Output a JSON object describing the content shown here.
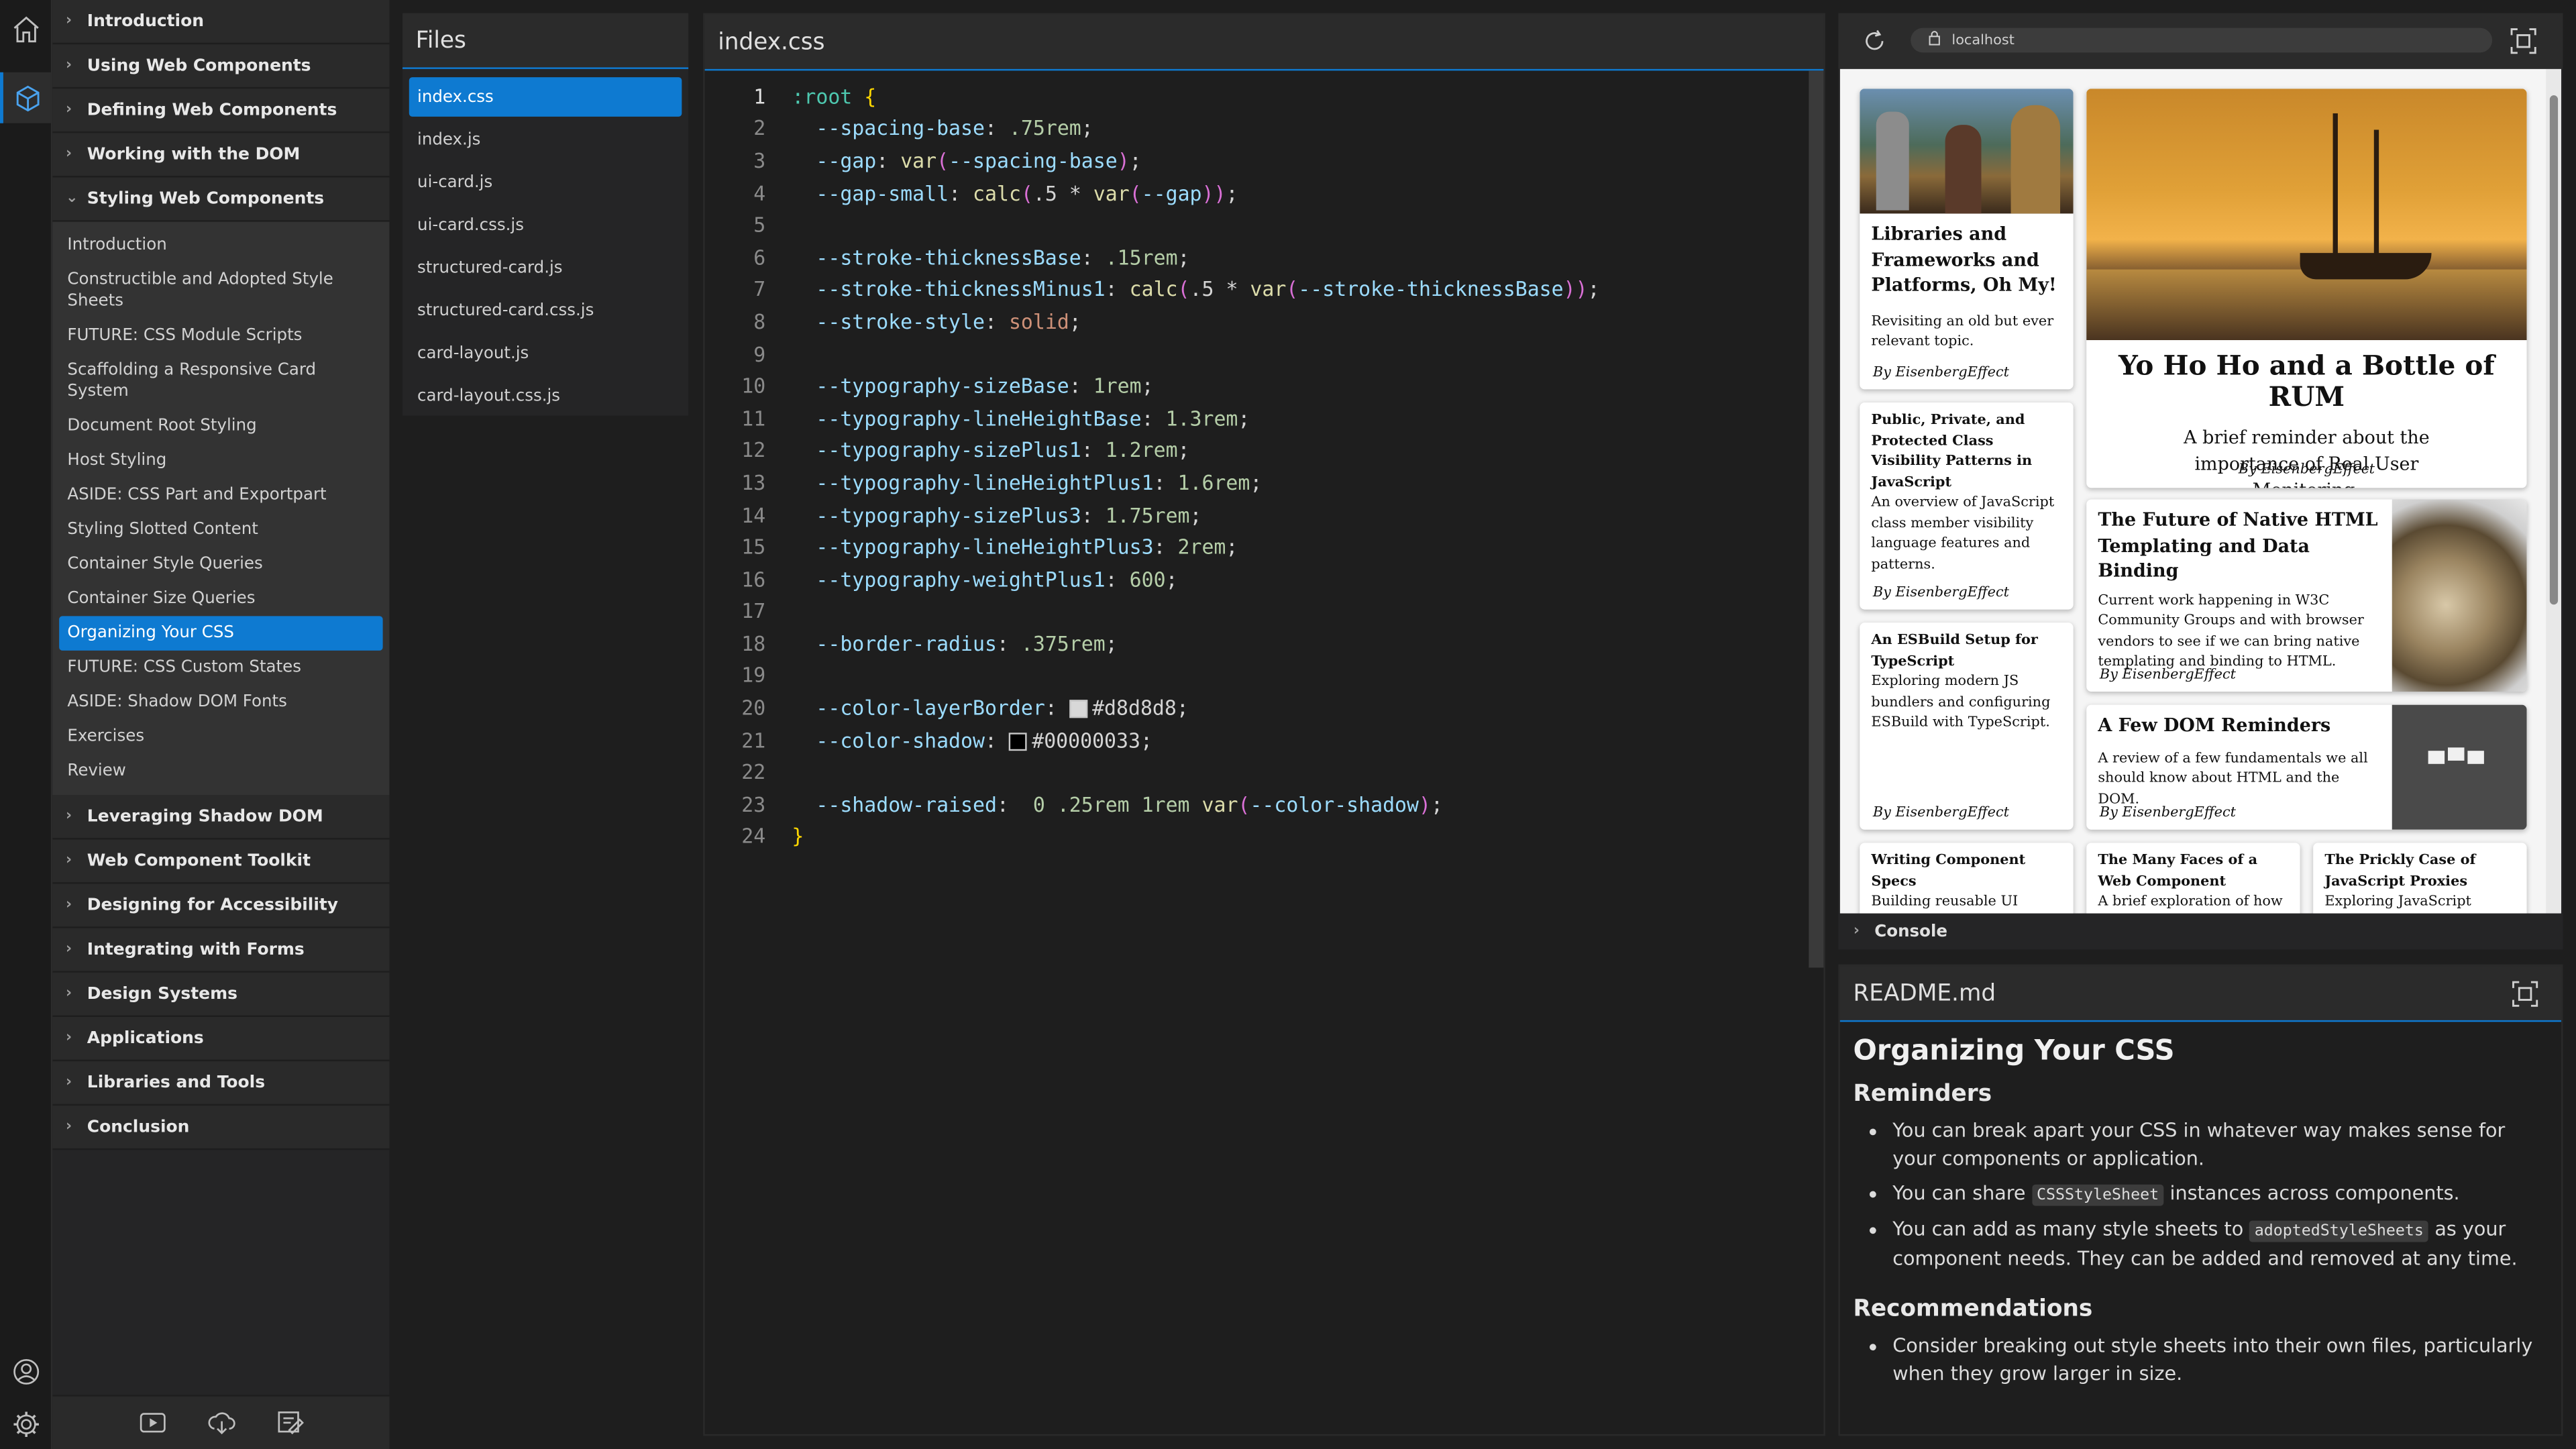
{
  "colors": {
    "accent": "#0e7ad1",
    "background": "#1e1e1e",
    "panel": "#252526"
  },
  "activity": {
    "icons": [
      "home-icon",
      "cube-icon",
      "user-icon",
      "gear-icon"
    ]
  },
  "toc": {
    "sections_before": [
      "Introduction",
      "Using Web Components",
      "Defining Web Components",
      "Working with the DOM"
    ],
    "expanded_section": "Styling Web Components",
    "subitems": [
      "Introduction",
      "Constructible and Adopted Style Sheets",
      "FUTURE: CSS Module Scripts",
      "Scaffolding a Responsive Card System",
      "Document Root Styling",
      "Host Styling",
      "ASIDE: CSS Part and Exportpart",
      "Styling Slotted Content",
      "Container Style Queries",
      "Container Size Queries",
      "Organizing Your CSS",
      "FUTURE: CSS Custom States",
      "ASIDE: Shadow DOM Fonts",
      "Exercises",
      "Review"
    ],
    "active_subitem": "Organizing Your CSS",
    "sections_after": [
      "Leveraging Shadow DOM",
      "Web Component Toolkit",
      "Designing for Accessibility",
      "Integrating with Forms",
      "Design Systems",
      "Applications",
      "Libraries and Tools",
      "Conclusion"
    ]
  },
  "sidebar_footer": {
    "icons": [
      "video-icon",
      "cloud-download-icon",
      "edit-note-icon"
    ]
  },
  "files": {
    "title": "Files",
    "items": [
      "index.css",
      "index.js",
      "ui-card.js",
      "ui-card.css.js",
      "structured-card.js",
      "structured-card.css.js",
      "card-layout.js",
      "card-layout.css.js"
    ],
    "active": "index.css"
  },
  "editor": {
    "title": "index.css",
    "lines": [
      {
        "n": "1",
        "code": ":root {"
      },
      {
        "n": "2",
        "code": "  --spacing-base: .75rem;"
      },
      {
        "n": "3",
        "code": "  --gap: var(--spacing-base);"
      },
      {
        "n": "4",
        "code": "  --gap-small: calc(.5 * var(--gap));"
      },
      {
        "n": "5",
        "code": ""
      },
      {
        "n": "6",
        "code": "  --stroke-thicknessBase: .15rem;"
      },
      {
        "n": "7",
        "code": "  --stroke-thicknessMinus1: calc(.5 * var(--stroke-thicknessBase));"
      },
      {
        "n": "8",
        "code": "  --stroke-style: solid;"
      },
      {
        "n": "9",
        "code": ""
      },
      {
        "n": "10",
        "code": "  --typography-sizeBase: 1rem;"
      },
      {
        "n": "11",
        "code": "  --typography-lineHeightBase: 1.3rem;"
      },
      {
        "n": "12",
        "code": "  --typography-sizePlus1: 1.2rem;"
      },
      {
        "n": "13",
        "code": "  --typography-lineHeightPlus1: 1.6rem;"
      },
      {
        "n": "14",
        "code": "  --typography-sizePlus3: 1.75rem;"
      },
      {
        "n": "15",
        "code": "  --typography-lineHeightPlus3: 2rem;"
      },
      {
        "n": "16",
        "code": "  --typography-weightPlus1: 600;"
      },
      {
        "n": "17",
        "code": ""
      },
      {
        "n": "18",
        "code": "  --border-radius: .375rem;"
      },
      {
        "n": "19",
        "code": ""
      },
      {
        "n": "20",
        "code": "  --color-layerBorder: #d8d8d8;"
      },
      {
        "n": "21",
        "code": "  --color-shadow: #00000033;"
      },
      {
        "n": "22",
        "code": ""
      },
      {
        "n": "23",
        "code": "  --shadow-raised:  0 .25rem 1rem var(--color-shadow);"
      },
      {
        "n": "24",
        "code": "}"
      }
    ]
  },
  "preview": {
    "url": "localhost",
    "cards": [
      {
        "title": "Libraries and Frameworks and Platforms, Oh My!",
        "desc": "Revisiting an old but ever relevant topic.",
        "by": "By EisenbergEffect"
      },
      {
        "title": "Yo Ho Ho and a Bottle of RUM",
        "desc": "A brief reminder about the importance of Real User Monitoring.",
        "by": "By EisenbergEffect"
      },
      {
        "title": "Public, Private, and Protected Class Visibility Patterns in JavaScript",
        "desc": "An overview of JavaScript class member visibility language features and patterns.",
        "by": "By EisenbergEffect"
      },
      {
        "title": "The Future of Native HTML Templating and Data Binding",
        "desc": "Current work happening in W3C Community Groups and with browser vendors to see if we can bring native templating and binding to HTML.",
        "by": "By EisenbergEffect"
      },
      {
        "title": "An ESBuild Setup for TypeScript",
        "desc": "Exploring modern JS bundlers and configuring ESBuild with TypeScript.",
        "by": "By EisenbergEffect"
      },
      {
        "title": "A Few DOM Reminders",
        "desc": "A review of a few fundamentals we all should know about HTML and the DOM.",
        "by": "By EisenbergEffect"
      },
      {
        "title": "Writing Component Specs",
        "desc": "Building reusable UI components is a challenging"
      },
      {
        "title": "The Many Faces of a Web Component",
        "desc": "A brief exploration of how"
      },
      {
        "title": "The Prickly Case of JavaScript Proxies",
        "desc": "Exploring JavaScript"
      }
    ],
    "console_label": "Console"
  },
  "readme": {
    "title": "README.md",
    "h1": "Organizing Your CSS",
    "reminders_heading": "Reminders",
    "reminders": [
      {
        "pre": "You can break apart your CSS in whatever way makes sense for your components or application.",
        "code": "",
        "post": ""
      },
      {
        "pre": "You can share ",
        "code": "CSSStyleSheet",
        "post": " instances across components."
      },
      {
        "pre": "You can add as many style sheets to ",
        "code": "adoptedStyleSheets",
        "post": " as your component needs. They can be added and removed at any time."
      }
    ],
    "recommendations_heading": "Recommendations",
    "recommendations": [
      "Consider breaking out style sheets into their own files, particularly when they grow larger in size."
    ]
  }
}
